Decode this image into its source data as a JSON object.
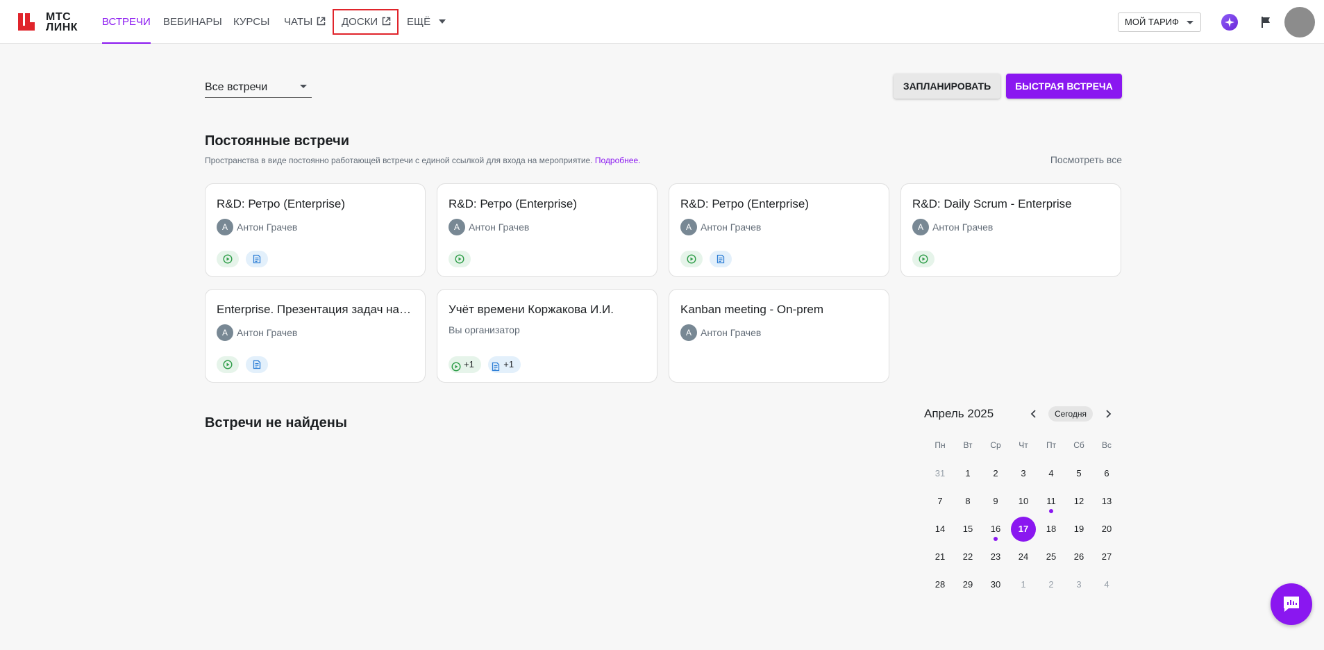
{
  "brand": {
    "line1": "МТС",
    "line2": "ЛИНК",
    "accent_color": "#8a17f0",
    "logo_color": "#e0242b"
  },
  "nav": {
    "items": [
      {
        "label": "ВСТРЕЧИ",
        "active": true
      },
      {
        "label": "ВЕБИНАРЫ"
      },
      {
        "label": "КУРСЫ"
      },
      {
        "label": "ЧАТЫ",
        "icon": "external-link-icon"
      },
      {
        "label": "ДОСКИ",
        "icon": "external-link-icon"
      },
      {
        "label": "ЕЩЁ",
        "icon": "chevron-down-icon"
      }
    ]
  },
  "header": {
    "tariff_label": "МОЙ ТАРИФ"
  },
  "toolbar": {
    "filter_value": "Все встречи",
    "plan_label": "ЗАПЛАНИРОВАТЬ",
    "quick_label": "БЫСТРАЯ ВСТРЕЧА"
  },
  "permanent": {
    "title": "Постоянные встречи",
    "desc": "Пространства в виде постоянно работающей встречи с единой ссылкой для входа на мероприятие.",
    "more_link": "Подробнее.",
    "view_all": "Посмотреть все",
    "cards": [
      {
        "title": "R&D: Ретро (Enterprise)",
        "avatar": "А",
        "owner": "Антон Грачев"
      },
      {
        "title": "R&D: Ретро (Enterprise)",
        "avatar": "А",
        "owner": "Антон Грачев"
      },
      {
        "title": "R&D: Ретро (Enterprise)",
        "avatar": "А",
        "owner": "Антон Грачев"
      },
      {
        "title": "R&D: Daily Scrum - Enterprise",
        "avatar": "А",
        "owner": "Антон Грачев"
      },
      {
        "title": "Enterprise. Презентация задач на …",
        "avatar": "А",
        "owner": "Антон Грачев"
      },
      {
        "title": "Учёт времени Коржакова И.И.",
        "subtitle": "Вы организатор",
        "record_count": "+1",
        "notes_count": "+1"
      },
      {
        "title": "Kanban meeting - On-prem",
        "avatar": "А",
        "owner": "Антон Грачев"
      }
    ]
  },
  "meetings": {
    "empty_title": "Встречи не найдены"
  },
  "calendar": {
    "month": "Апрель 2025",
    "today_label": "Сегодня",
    "weekdays": [
      "Пн",
      "Вт",
      "Ср",
      "Чт",
      "Пт",
      "Сб",
      "Вс"
    ],
    "weeks": [
      [
        "31",
        "1",
        "2",
        "3",
        "4",
        "5",
        "6"
      ],
      [
        "7",
        "8",
        "9",
        "10",
        "11",
        "12",
        "13"
      ],
      [
        "14",
        "15",
        "16",
        "17",
        "18",
        "19",
        "20"
      ],
      [
        "21",
        "22",
        "23",
        "24",
        "25",
        "26",
        "27"
      ],
      [
        "28",
        "29",
        "30",
        "1",
        "2",
        "3",
        "4"
      ]
    ],
    "selected_day": "17",
    "event_days": [
      "11",
      "16"
    ]
  }
}
